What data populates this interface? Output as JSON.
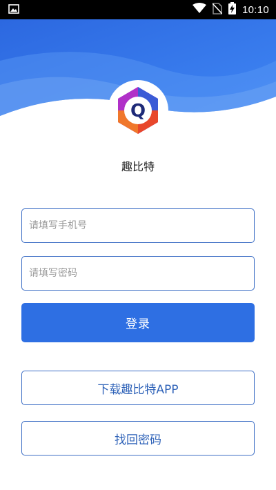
{
  "status_bar": {
    "time": "10:10",
    "icons": [
      "image-notification-icon",
      "wifi-icon",
      "no-sim-icon",
      "battery-charging-icon"
    ]
  },
  "app": {
    "name": "趣比特",
    "logo_icon": "qubit-logo-icon",
    "logo_letter": "Q"
  },
  "login_form": {
    "phone_placeholder": "请填写手机号",
    "phone_value": "",
    "password_placeholder": "请填写密码",
    "password_value": "",
    "login_label": "登录"
  },
  "actions": {
    "download_label": "下载趣比特APP",
    "recover_password_label": "找回密码"
  },
  "colors": {
    "header_blue": "#2e6fe3",
    "primary_button": "#2e6fe3",
    "outline_border": "#3a6cc4",
    "outline_text": "#2e62b8"
  }
}
